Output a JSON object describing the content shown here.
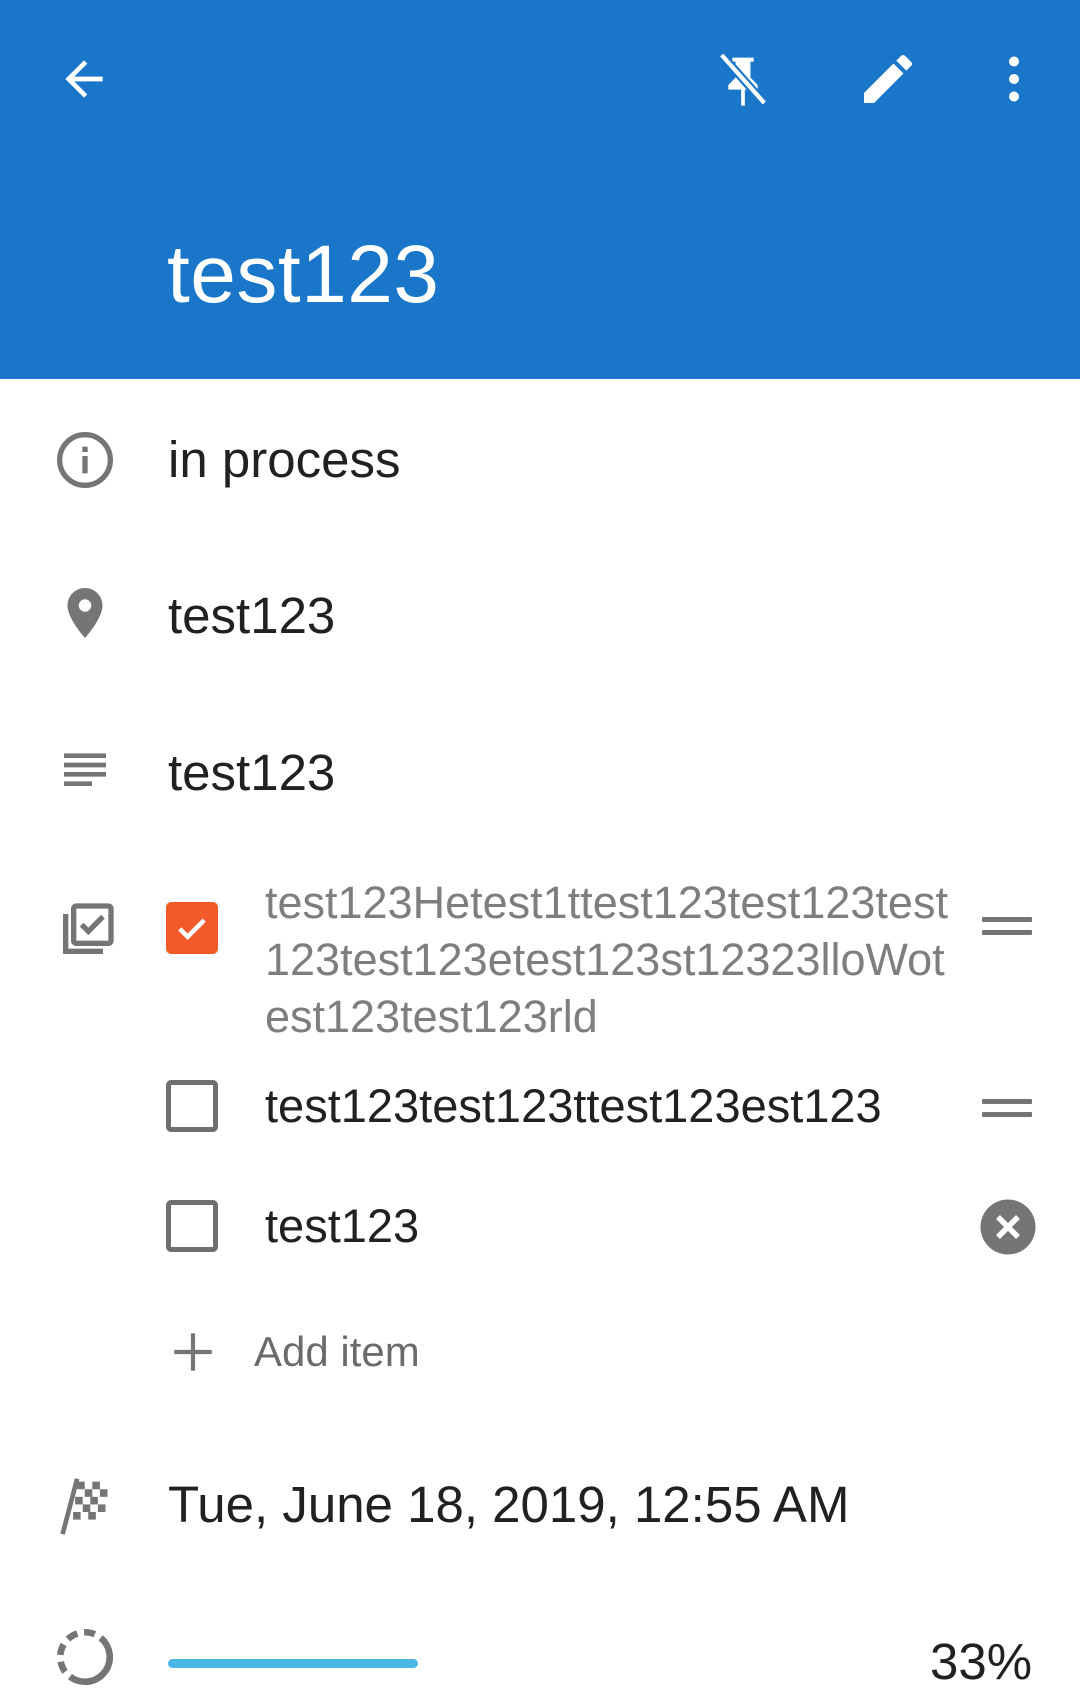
{
  "appbar": {
    "title": "test123",
    "color": "#1976c9",
    "actions": [
      {
        "name": "back-icon"
      },
      {
        "name": "unpin-icon"
      },
      {
        "name": "edit-icon"
      },
      {
        "name": "more-vert-icon"
      }
    ]
  },
  "details": {
    "status": {
      "icon": "info-icon",
      "text": "in process"
    },
    "location": {
      "icon": "location-pin-icon",
      "text": "test123"
    },
    "description": {
      "icon": "notes-icon",
      "text": "test123"
    }
  },
  "checklist": {
    "icon": "checklist-icon",
    "items": [
      {
        "text": "test123Hetest1ttest123test123test123test123etest123st12323lloWotest123test123rld",
        "checked": true
      },
      {
        "text": "test123test123ttest123est123",
        "checked": false
      },
      {
        "text": "test123",
        "checked": false
      }
    ],
    "add_label": "Add item",
    "accent": "#f35a2a"
  },
  "due": {
    "icon": "checkered-flag-icon",
    "text": "Tue, June 18, 2019, 12:55 AM"
  },
  "progress": {
    "icon": "progress-circle-icon",
    "value": 0.33,
    "label": "33%",
    "color": "#4ab8e6"
  }
}
